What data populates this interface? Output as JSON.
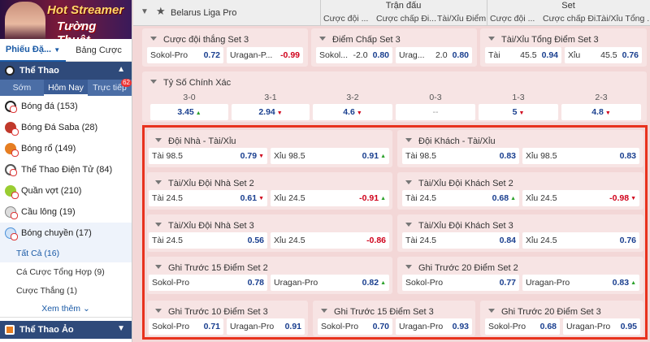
{
  "banner": {
    "line1": "Hot Streamer",
    "line2": "Tường Thuật"
  },
  "sidebar": {
    "tabs": [
      "Phiếu Đặ...",
      "Bảng Cược"
    ],
    "sports_header": "Thể Thao",
    "subtabs": [
      "Sớm",
      "Hôm Nay",
      "Trực tiếp"
    ],
    "live_badge": "62",
    "sports": [
      {
        "label": "Bóng đá (153)",
        "color": "#222"
      },
      {
        "label": "Bóng Đá Saba (28)",
        "color": "#c0392b"
      },
      {
        "label": "Bóng rổ (149)",
        "color": "#e67e22"
      },
      {
        "label": "Thể Thao Điện Tử (84)",
        "color": "#555"
      },
      {
        "label": "Quần vợt (210)",
        "color": "#9acd32"
      },
      {
        "label": "Cầu lông (19)",
        "color": "#888"
      },
      {
        "label": "Bóng chuyền (17)",
        "color": "#4a90d9"
      }
    ],
    "sub_items": [
      "Tất Cả (16)",
      "Cá Cược Tổng Hợp (9)",
      "Cược Thắng (1)"
    ],
    "more": "Xem thêm",
    "virtual_header": "Thể Thao Ảo"
  },
  "header": {
    "league": "Belarus Liga Pro",
    "group_match": "Trận đấu",
    "group_set": "Set",
    "cols": [
      "Cược đội ...",
      "Cược chấp Đi...",
      "Tài/Xỉu Điểm",
      "Cược đội ...",
      "Cược chấp Đi...",
      "Tài/Xỉu Tổng ..."
    ]
  },
  "cards": {
    "c1": {
      "title": "Cược đội thắng Set 3",
      "l": "Sokol-Pro",
      "lo": "0.72",
      "r": "Uragan-P...",
      "ro": "-0.99"
    },
    "c2": {
      "title": "Điểm Chấp Set 3",
      "l": "Sokol...",
      "lh": "-2.0",
      "lo": "0.80",
      "r": "Urag...",
      "rh": "2.0",
      "ro": "0.80"
    },
    "c3": {
      "title": "Tài/Xỉu Tổng Điểm Set 3",
      "l": "Tài",
      "lh": "45.5",
      "lo": "0.94",
      "r": "Xỉu",
      "rh": "45.5",
      "ro": "0.76"
    },
    "cs": {
      "title": "Tỷ Số Chính Xác",
      "items": [
        {
          "s": "3-0",
          "o": "3.45"
        },
        {
          "s": "3-1",
          "o": "2.94"
        },
        {
          "s": "3-2",
          "o": "4.6"
        },
        {
          "s": "0-3",
          "o": "--"
        },
        {
          "s": "1-3",
          "o": "5"
        },
        {
          "s": "2-3",
          "o": "4.8"
        }
      ]
    },
    "c4": {
      "title": "Đội Nhà - Tài/Xỉu",
      "l": "Tài 98.5",
      "lo": "0.79",
      "r": "Xỉu 98.5",
      "ro": "0.91"
    },
    "c5": {
      "title": "Đội Khách - Tài/Xỉu",
      "l": "Tài 98.5",
      "lo": "0.83",
      "r": "Xỉu 98.5",
      "ro": "0.83"
    },
    "c6": {
      "title": "Tài/Xỉu Đội Nhà Set 2",
      "l": "Tài 24.5",
      "lo": "0.61",
      "r": "Xỉu 24.5",
      "ro": "-0.91"
    },
    "c7": {
      "title": "Tài/Xỉu Đội Khách Set 2",
      "l": "Tài 24.5",
      "lo": "0.68",
      "r": "Xỉu 24.5",
      "ro": "-0.98"
    },
    "c8": {
      "title": "Tài/Xỉu Đội Nhà Set 3",
      "l": "Tài 24.5",
      "lo": "0.56",
      "r": "Xỉu 24.5",
      "ro": "-0.86"
    },
    "c9": {
      "title": "Tài/Xỉu Đội Khách Set 3",
      "l": "Tài 24.5",
      "lo": "0.84",
      "r": "Xỉu 24.5",
      "ro": "0.76"
    },
    "c10": {
      "title": "Ghi Trước 15 Điểm Set 2",
      "l": "Sokol-Pro",
      "lo": "0.78",
      "r": "Uragan-Pro",
      "ro": "0.82"
    },
    "c11": {
      "title": "Ghi Trước 20 Điểm Set 2",
      "l": "Sokol-Pro",
      "lo": "0.77",
      "r": "Uragan-Pro",
      "ro": "0.83"
    },
    "c12": {
      "title": "Ghi Trước 10 Điểm Set 3",
      "l": "Sokol-Pro",
      "lo": "0.71",
      "r": "Uragan-Pro",
      "ro": "0.91"
    },
    "c13": {
      "title": "Ghi Trước 15 Điểm Set 3",
      "l": "Sokol-Pro",
      "lo": "0.70",
      "r": "Uragan-Pro",
      "ro": "0.93"
    },
    "c14": {
      "title": "Ghi Trước 20 Điểm Set 3",
      "l": "Sokol-Pro",
      "lo": "0.68",
      "r": "Uragan-Pro",
      "ro": "0.95"
    }
  },
  "colors": {
    "highlight": "#e8321e",
    "odds": "#1a3f8f",
    "negative": "#d0021b",
    "up": "#2aa12a"
  }
}
